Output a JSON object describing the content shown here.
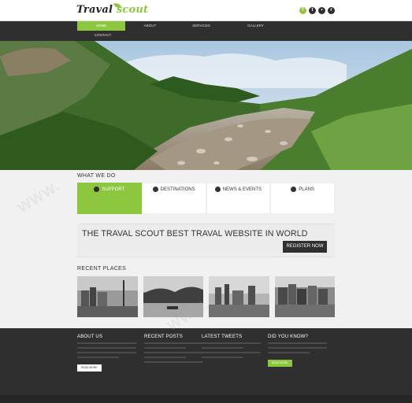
{
  "brand": {
    "logo_main": "Traval",
    "logo_accent": "scout"
  },
  "social": [
    {
      "icon": "facebook-icon",
      "glyph": "f",
      "color": "#8dc63f"
    },
    {
      "icon": "twitter-icon",
      "glyph": "t",
      "color": "#2f2f2f"
    },
    {
      "icon": "flickr-icon",
      "glyph": "•",
      "color": "#2f2f2f"
    },
    {
      "icon": "rss-icon",
      "glyph": "r",
      "color": "#2f2f2f"
    }
  ],
  "nav": {
    "items": [
      {
        "label": "HOME",
        "active": true
      },
      {
        "label": "ABOUT"
      },
      {
        "label": "SERVICES"
      },
      {
        "label": "GALLERY"
      },
      {
        "label": "CONTACT"
      }
    ]
  },
  "what_we_do": {
    "title": "WHAT WE DO",
    "services": [
      {
        "label": "SUPPORT",
        "icon": "support-icon",
        "active": true
      },
      {
        "label": "DESTINATIONS",
        "icon": "globe-icon"
      },
      {
        "label": "NEWS & EVENTS",
        "icon": "coffee-icon"
      },
      {
        "label": "PLANS",
        "icon": "clock-icon"
      }
    ]
  },
  "banner": {
    "title": "THE TRAVAL SCOUT BEST TRAVAL WEBSITE IN WORLD",
    "button": "REGISTER NOW"
  },
  "recent_places": {
    "title": "RECENT PLACES"
  },
  "footer": {
    "about": {
      "title": "ABOUT US",
      "button": "READ MORE"
    },
    "posts": {
      "title": "RECENT POSTS"
    },
    "tweets": {
      "title": "LATEST TWEETS"
    },
    "know": {
      "title": "DID YOU KNOW?",
      "button": "READ MORE"
    }
  },
  "colors": {
    "accent": "#8dc63f",
    "dark": "#2f2f2f"
  }
}
